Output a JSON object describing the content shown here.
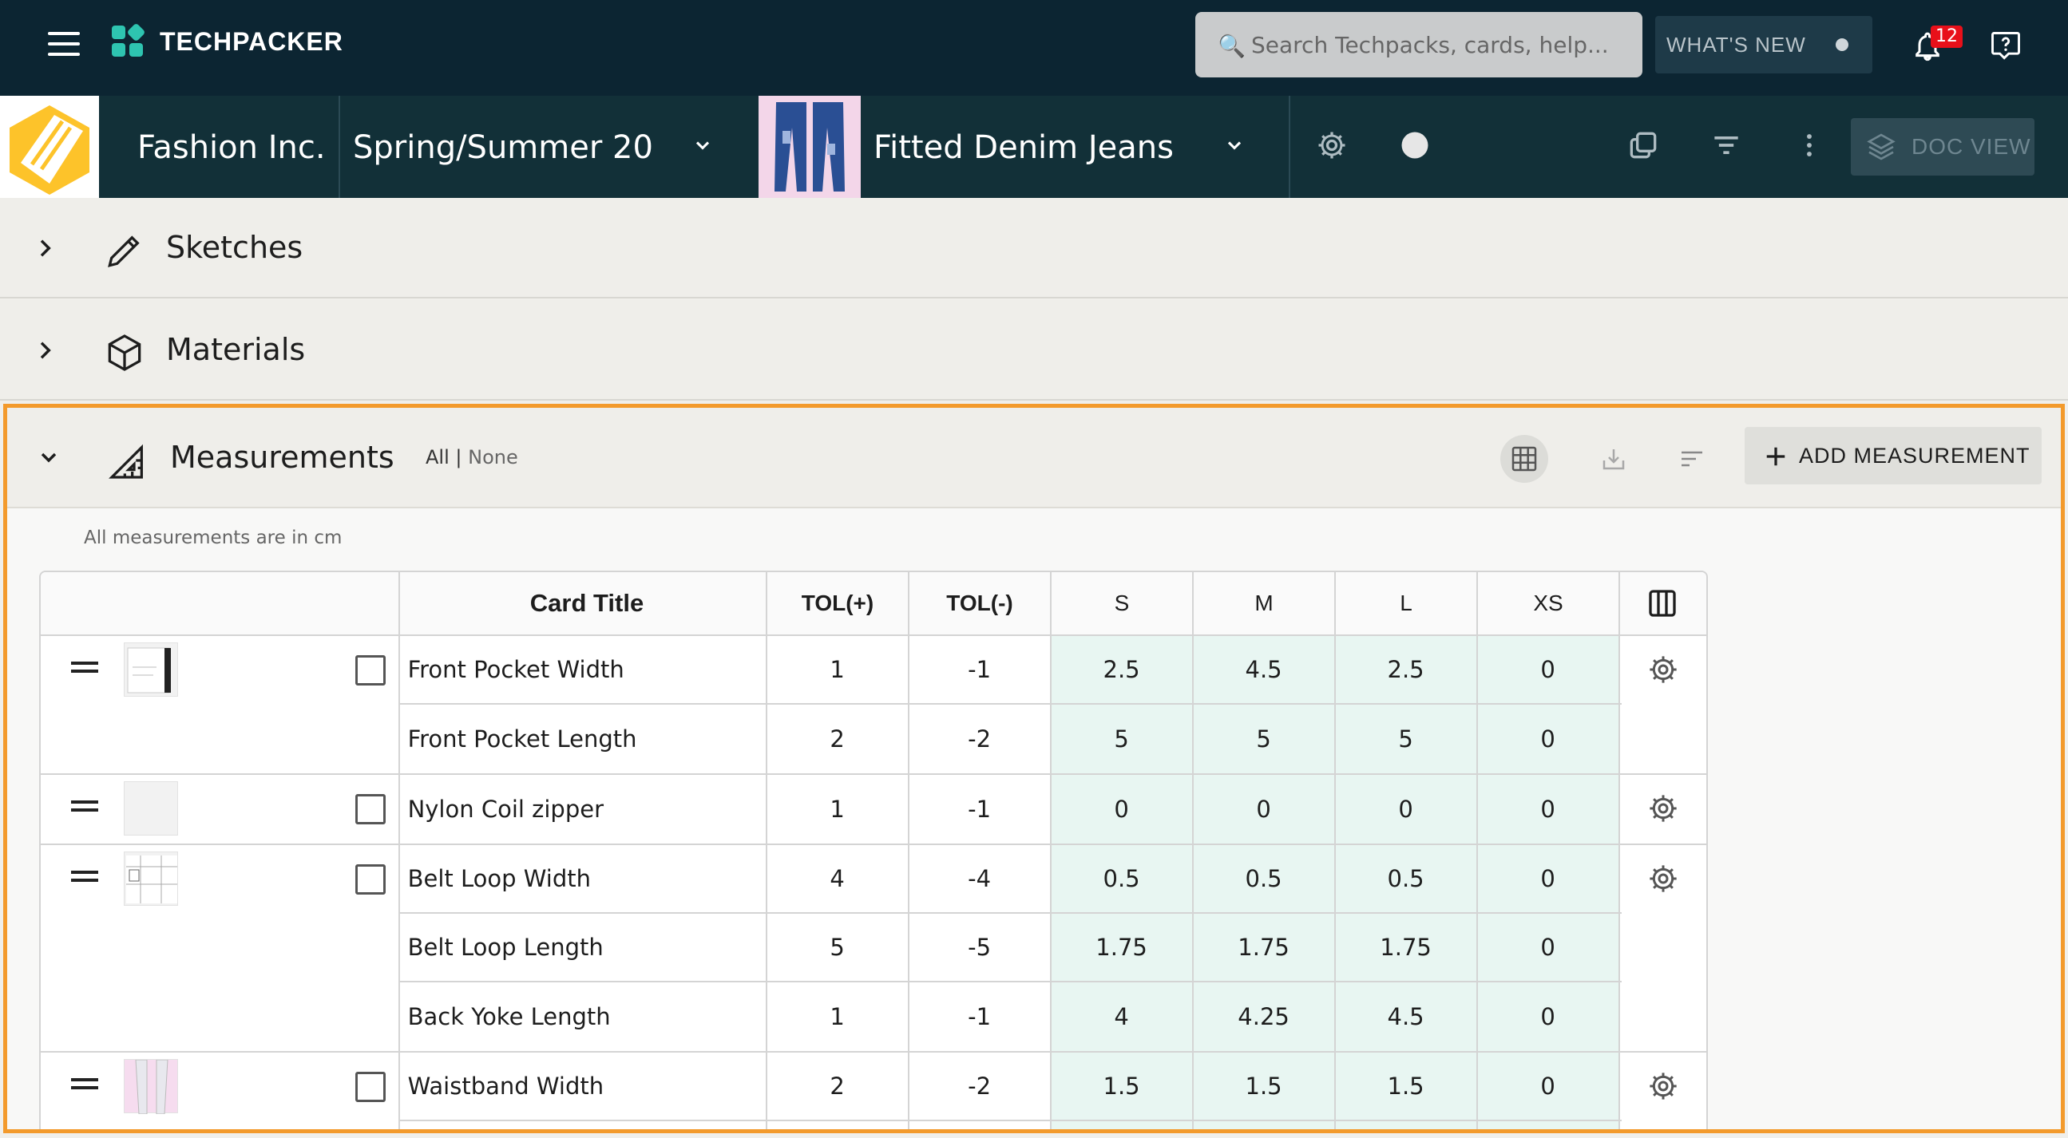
{
  "header": {
    "brand": "TECHPACKER",
    "search_placeholder": "Search Techpacks, cards, help...",
    "whats_new": "WHAT'S NEW",
    "notifications_count": "12"
  },
  "subbar": {
    "company": "Fashion Inc.",
    "season": "Spring/Summer 20",
    "product": "Fitted Denim Jeans",
    "doc_view": "DOC VIEW"
  },
  "sections": {
    "sketches": "Sketches",
    "materials": "Materials"
  },
  "measurements": {
    "title": "Measurements",
    "filter_all": "All",
    "filter_sep": "|",
    "filter_none": "None",
    "add_label": "ADD MEASUREMENT",
    "unit_note": "All measurements are in cm",
    "columns": [
      "Card Title",
      "TOL(+)",
      "TOL(-)",
      "S",
      "M",
      "L",
      "XS"
    ],
    "groups": [
      {
        "rows": [
          {
            "title": "Front Pocket Width",
            "tol_plus": "1",
            "tol_minus": "-1",
            "s": "2.5",
            "m": "4.5",
            "l": "2.5",
            "xs": "0"
          },
          {
            "title": "Front Pocket Length",
            "tol_plus": "2",
            "tol_minus": "-2",
            "s": "5",
            "m": "5",
            "l": "5",
            "xs": "0"
          }
        ]
      },
      {
        "rows": [
          {
            "title": "Nylon Coil zipper",
            "tol_plus": "1",
            "tol_minus": "-1",
            "s": "0",
            "m": "0",
            "l": "0",
            "xs": "0"
          }
        ]
      },
      {
        "rows": [
          {
            "title": "Belt Loop Width",
            "tol_plus": "4",
            "tol_minus": "-4",
            "s": "0.5",
            "m": "0.5",
            "l": "0.5",
            "xs": "0"
          },
          {
            "title": "Belt Loop Length",
            "tol_plus": "5",
            "tol_minus": "-5",
            "s": "1.75",
            "m": "1.75",
            "l": "1.75",
            "xs": "0"
          },
          {
            "title": "Back Yoke Length",
            "tol_plus": "1",
            "tol_minus": "-1",
            "s": "4",
            "m": "4.25",
            "l": "4.5",
            "xs": "0"
          }
        ]
      },
      {
        "rows": [
          {
            "title": "Waistband Width",
            "tol_plus": "2",
            "tol_minus": "-2",
            "s": "1.5",
            "m": "1.5",
            "l": "1.5",
            "xs": "0"
          }
        ]
      }
    ]
  },
  "colors": {
    "topbar": "#0c2532",
    "subbar": "#123038",
    "accent_teal": "#2ec4b0",
    "highlight_orange": "#f39a2c",
    "size_cell_bg": "#e8f6f2",
    "badge_red": "#e8101a"
  },
  "icons": [
    "menu-icon",
    "search-icon",
    "bell-icon",
    "help-icon",
    "chevron-down-icon",
    "settings-icon",
    "copy-icon",
    "filter-icon",
    "more-vert-icon",
    "layers-icon",
    "pencil-icon",
    "cube-icon",
    "ruler-icon",
    "grid-icon",
    "import-icon",
    "sort-icon",
    "plus-icon",
    "drag-handle-icon",
    "gear-icon",
    "columns-icon"
  ]
}
